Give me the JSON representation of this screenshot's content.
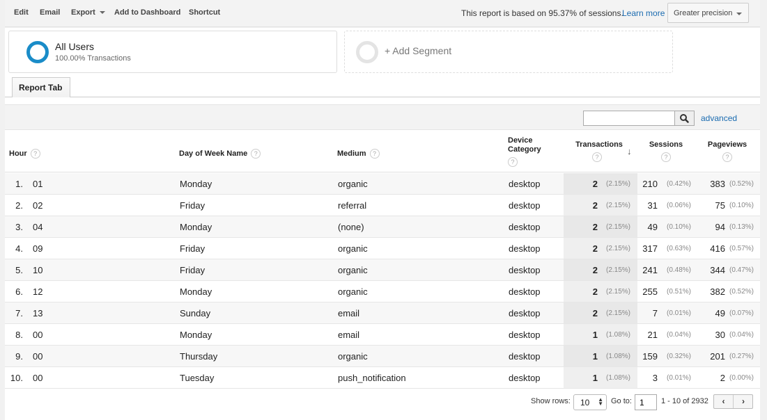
{
  "toolbar": {
    "edit": "Edit",
    "email": "Email",
    "export": "Export",
    "add_to_dashboard": "Add to Dashboard",
    "shortcut": "Shortcut",
    "sampling_text": "This report is based on 95.37% of sessions.",
    "learn_more": "Learn more",
    "precision_select": "Greater precision"
  },
  "segments": {
    "active": {
      "title": "All Users",
      "subtitle": "100.00% Transactions",
      "color": "#1a8cc8"
    },
    "add_label": "+ Add Segment"
  },
  "tabs": [
    {
      "label": "Report Tab",
      "active": true
    }
  ],
  "filter": {
    "search_value": "",
    "advanced_label": "advanced"
  },
  "table": {
    "columns": {
      "hour": "Hour",
      "day": "Day of Week Name",
      "medium": "Medium",
      "device": "Device Category",
      "transactions": "Transactions",
      "sessions": "Sessions",
      "pageviews": "Pageviews"
    },
    "help_glyph": "?",
    "sort_glyph": "↓",
    "rows": [
      {
        "index": "1.",
        "hour": "01",
        "day": "Monday",
        "medium": "organic",
        "device": "desktop",
        "transactions": "2",
        "transactions_pct": "(2.15%)",
        "sessions": "210",
        "sessions_pct": "(0.42%)",
        "pageviews": "383",
        "pageviews_pct": "(0.52%)"
      },
      {
        "index": "2.",
        "hour": "02",
        "day": "Friday",
        "medium": "referral",
        "device": "desktop",
        "transactions": "2",
        "transactions_pct": "(2.15%)",
        "sessions": "31",
        "sessions_pct": "(0.06%)",
        "pageviews": "75",
        "pageviews_pct": "(0.10%)"
      },
      {
        "index": "3.",
        "hour": "04",
        "day": "Monday",
        "medium": "(none)",
        "device": "desktop",
        "transactions": "2",
        "transactions_pct": "(2.15%)",
        "sessions": "49",
        "sessions_pct": "(0.10%)",
        "pageviews": "94",
        "pageviews_pct": "(0.13%)"
      },
      {
        "index": "4.",
        "hour": "09",
        "day": "Friday",
        "medium": "organic",
        "device": "desktop",
        "transactions": "2",
        "transactions_pct": "(2.15%)",
        "sessions": "317",
        "sessions_pct": "(0.63%)",
        "pageviews": "416",
        "pageviews_pct": "(0.57%)"
      },
      {
        "index": "5.",
        "hour": "10",
        "day": "Friday",
        "medium": "organic",
        "device": "desktop",
        "transactions": "2",
        "transactions_pct": "(2.15%)",
        "sessions": "241",
        "sessions_pct": "(0.48%)",
        "pageviews": "344",
        "pageviews_pct": "(0.47%)"
      },
      {
        "index": "6.",
        "hour": "12",
        "day": "Monday",
        "medium": "organic",
        "device": "desktop",
        "transactions": "2",
        "transactions_pct": "(2.15%)",
        "sessions": "255",
        "sessions_pct": "(0.51%)",
        "pageviews": "382",
        "pageviews_pct": "(0.52%)"
      },
      {
        "index": "7.",
        "hour": "13",
        "day": "Sunday",
        "medium": "email",
        "device": "desktop",
        "transactions": "2",
        "transactions_pct": "(2.15%)",
        "sessions": "7",
        "sessions_pct": "(0.01%)",
        "pageviews": "49",
        "pageviews_pct": "(0.07%)"
      },
      {
        "index": "8.",
        "hour": "00",
        "day": "Monday",
        "medium": "email",
        "device": "desktop",
        "transactions": "1",
        "transactions_pct": "(1.08%)",
        "sessions": "21",
        "sessions_pct": "(0.04%)",
        "pageviews": "30",
        "pageviews_pct": "(0.04%)"
      },
      {
        "index": "9.",
        "hour": "00",
        "day": "Thursday",
        "medium": "organic",
        "device": "desktop",
        "transactions": "1",
        "transactions_pct": "(1.08%)",
        "sessions": "159",
        "sessions_pct": "(0.32%)",
        "pageviews": "201",
        "pageviews_pct": "(0.27%)"
      },
      {
        "index": "10.",
        "hour": "00",
        "day": "Tuesday",
        "medium": "push_notification",
        "device": "desktop",
        "transactions": "1",
        "transactions_pct": "(1.08%)",
        "sessions": "3",
        "sessions_pct": "(0.01%)",
        "pageviews": "2",
        "pageviews_pct": "(0.00%)"
      }
    ]
  },
  "footer": {
    "show_rows_label": "Show rows:",
    "show_rows_value": "10",
    "goto_label": "Go to:",
    "goto_value": "1",
    "range_text": "1 - 10 of 2932",
    "prev_glyph": "‹",
    "next_glyph": "›"
  }
}
